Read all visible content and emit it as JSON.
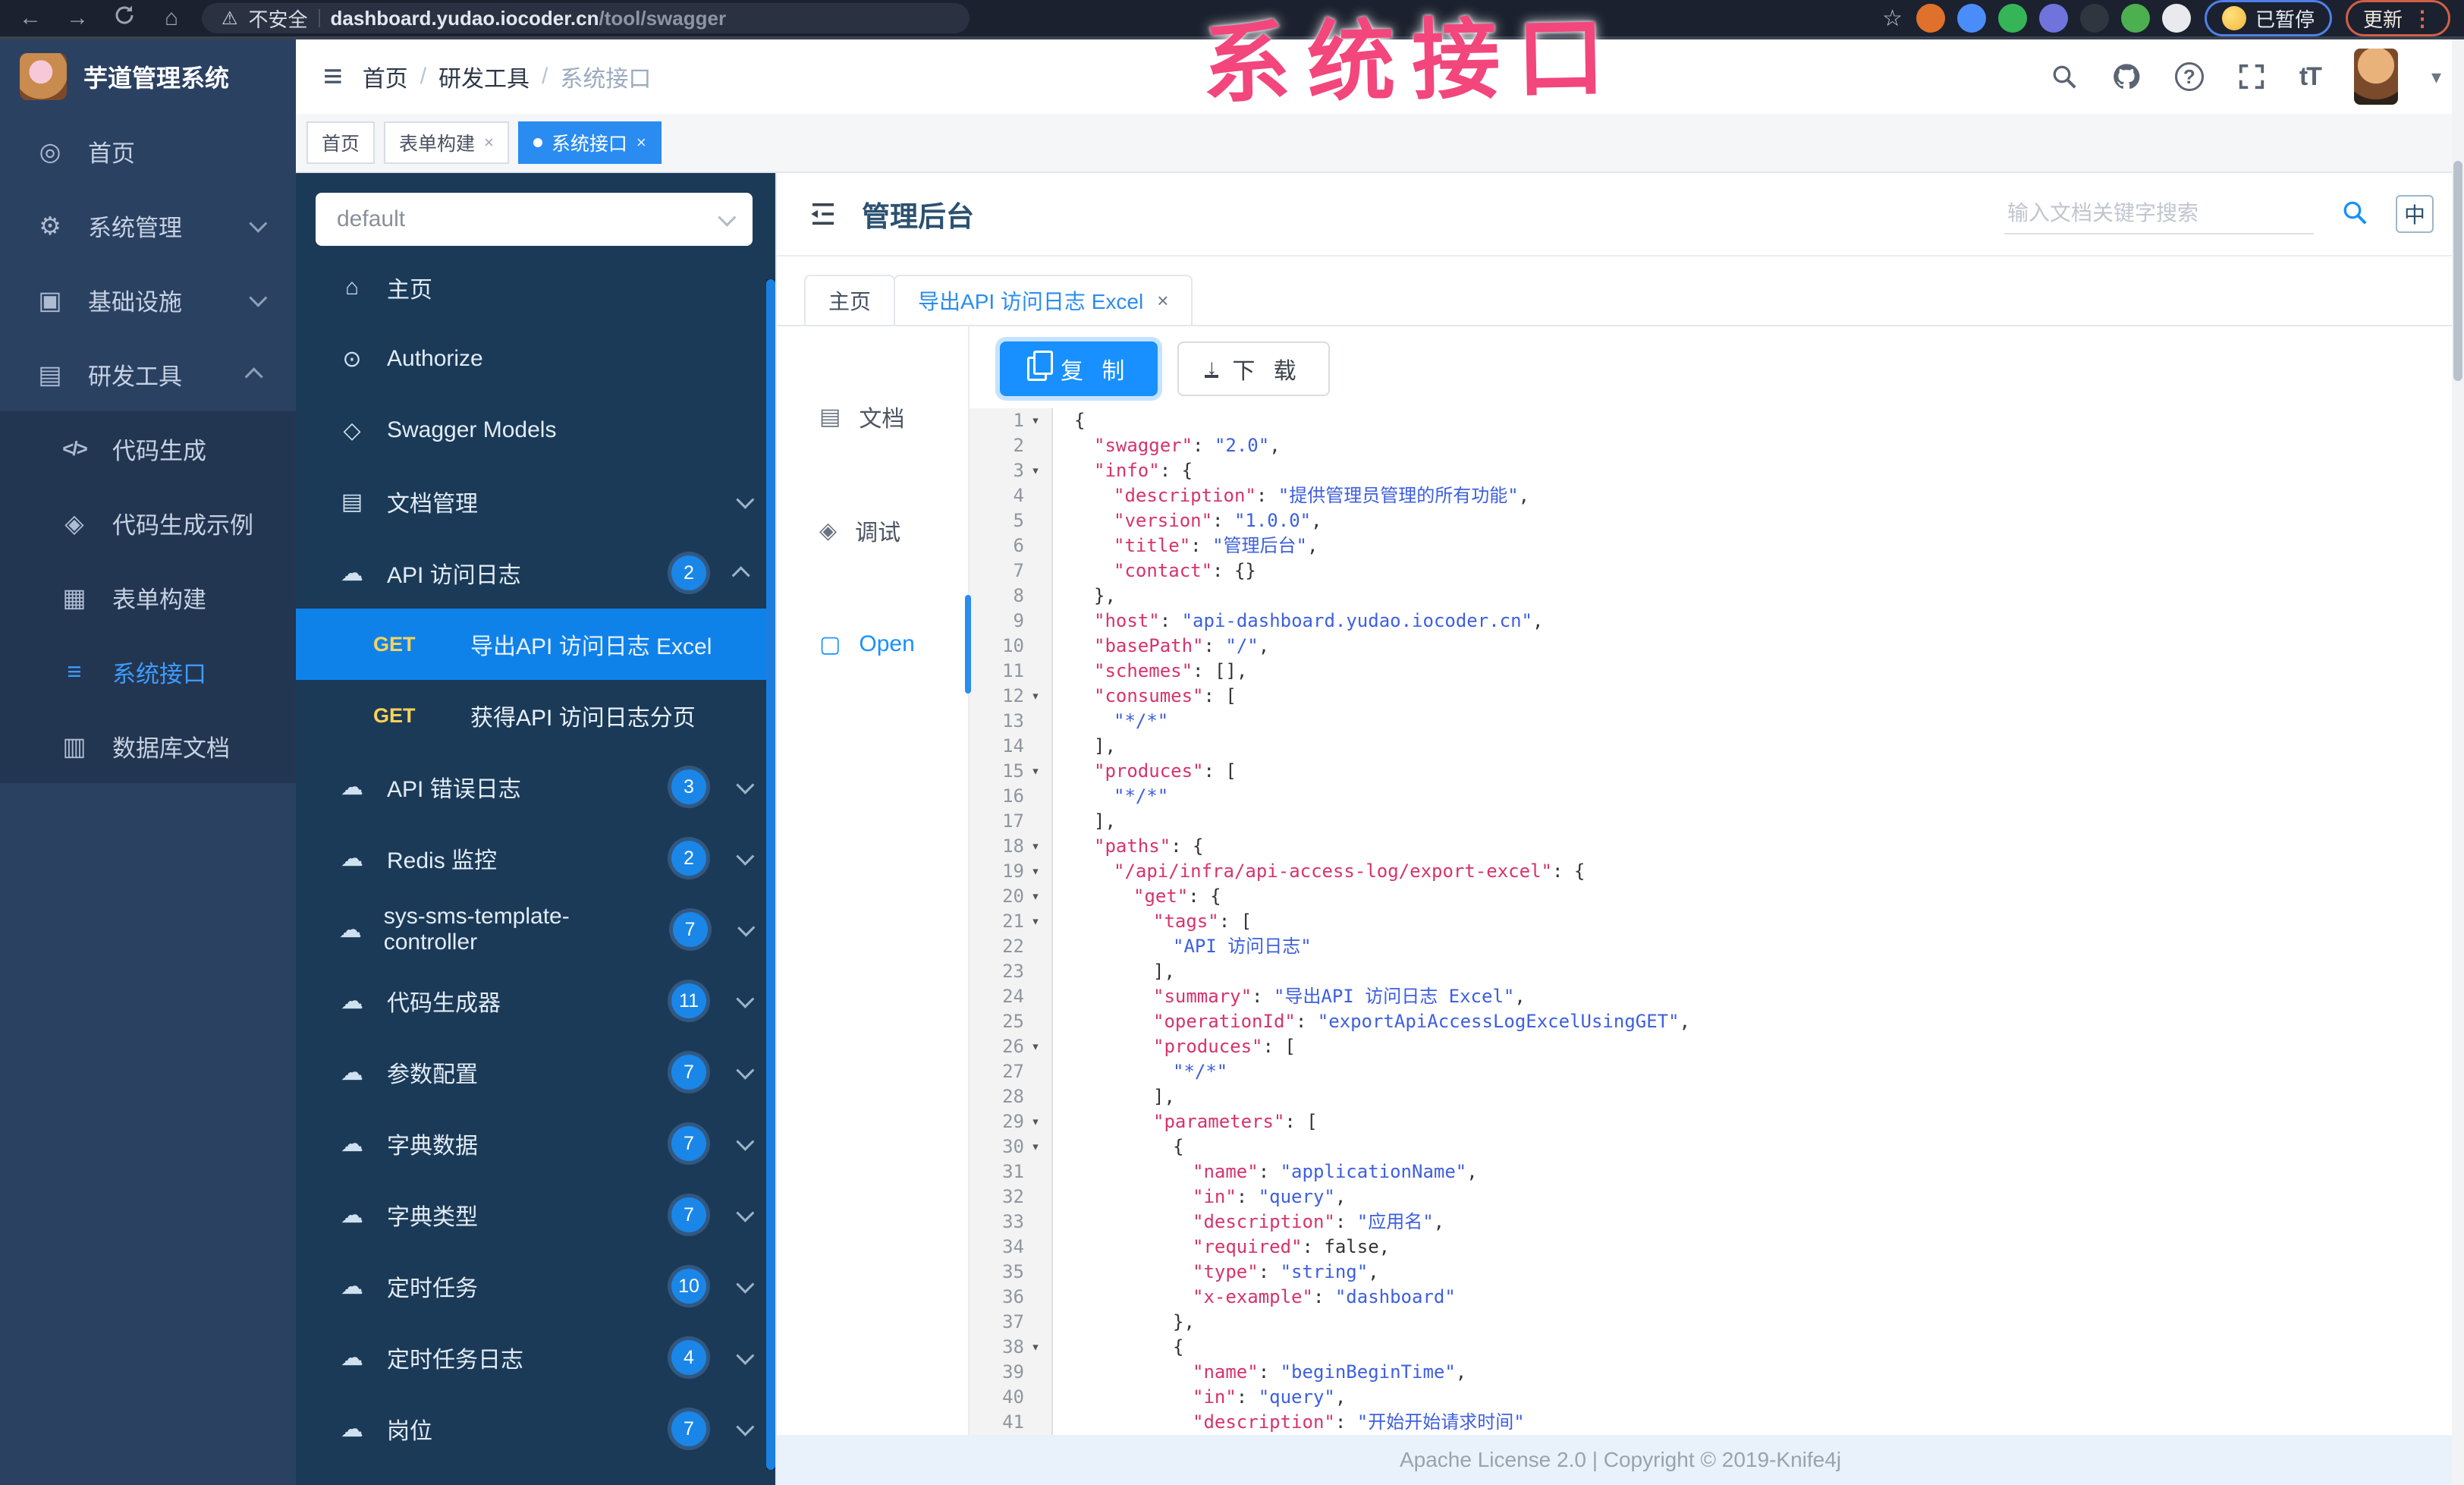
{
  "browser": {
    "security_label": "不安全",
    "url_host": "dashboard.yudao.iocoder.cn",
    "url_path": "/tool/swagger",
    "paused_label": "已暂停",
    "update_label": "更新",
    "menu_dots": "⋮",
    "extensions": [
      "#e0712c",
      "#4b8df8",
      "#35b558",
      "#6f74dd",
      "#2f3640",
      "#4caf50",
      "#e8eaed"
    ]
  },
  "overlay": {
    "title": "系统接口"
  },
  "logo": {
    "title": "芋道管理系统"
  },
  "sidebar": {
    "items": [
      {
        "id": "home",
        "label": "首页",
        "icon": "dashboard",
        "glyph": "◎"
      },
      {
        "id": "system",
        "label": "系统管理",
        "icon": "gear",
        "glyph": "⚙",
        "chevron": "down"
      },
      {
        "id": "infra",
        "label": "基础设施",
        "icon": "monitor",
        "glyph": "▣",
        "chevron": "down"
      },
      {
        "id": "devtools",
        "label": "研发工具",
        "icon": "toolbox",
        "glyph": "▤",
        "chevron": "up"
      }
    ],
    "subitems": [
      {
        "id": "codegen",
        "label": "代码生成",
        "icon": "code",
        "glyph": "</>"
      },
      {
        "id": "codegen-demo",
        "label": "代码生成示例",
        "icon": "shield",
        "glyph": "◈"
      },
      {
        "id": "form-builder",
        "label": "表单构建",
        "icon": "form",
        "glyph": "▦"
      },
      {
        "id": "api-doc",
        "label": "系统接口",
        "icon": "api",
        "glyph": "≡",
        "active": true
      },
      {
        "id": "db-doc",
        "label": "数据库文档",
        "icon": "database",
        "glyph": "▥"
      }
    ]
  },
  "header": {
    "breadcrumb": [
      "首页",
      "研发工具",
      "系统接口"
    ],
    "font_icon": "tT"
  },
  "tags": [
    {
      "label": "首页"
    },
    {
      "label": "表单构建",
      "closable": true
    },
    {
      "label": "系统接口",
      "closable": true,
      "active": true
    }
  ],
  "api_sidebar": {
    "group_select": "default",
    "items": [
      {
        "label": "主页",
        "icon": "home"
      },
      {
        "label": "Authorize",
        "icon": "auth"
      },
      {
        "label": "Swagger Models",
        "icon": "models"
      },
      {
        "label": "文档管理",
        "icon": "doc",
        "chevron": "down"
      },
      {
        "label": "API 访问日志",
        "icon": "cloud",
        "badge": "2",
        "chevron": "up",
        "children": [
          {
            "method": "GET",
            "label": "导出API 访问日志 Excel",
            "selected": true
          },
          {
            "method": "GET",
            "label": "获得API 访问日志分页"
          }
        ]
      },
      {
        "label": "API 错误日志",
        "icon": "cloud",
        "badge": "3",
        "chevron": "down"
      },
      {
        "label": "Redis 监控",
        "icon": "cloud",
        "badge": "2",
        "chevron": "down"
      },
      {
        "label": "sys-sms-template-controller",
        "icon": "cloud",
        "badge": "7",
        "chevron": "down"
      },
      {
        "label": "代码生成器",
        "icon": "cloud",
        "badge": "11",
        "chevron": "down"
      },
      {
        "label": "参数配置",
        "icon": "cloud",
        "badge": "7",
        "chevron": "down"
      },
      {
        "label": "字典数据",
        "icon": "cloud",
        "badge": "7",
        "chevron": "down"
      },
      {
        "label": "字典类型",
        "icon": "cloud",
        "badge": "7",
        "chevron": "down"
      },
      {
        "label": "定时任务",
        "icon": "cloud",
        "badge": "10",
        "chevron": "down"
      },
      {
        "label": "定时任务日志",
        "icon": "cloud",
        "badge": "4",
        "chevron": "down"
      },
      {
        "label": "岗位",
        "icon": "cloud",
        "badge": "7",
        "chevron": "down",
        "partial": true
      }
    ]
  },
  "doc": {
    "title": "管理后台",
    "search_placeholder": "输入文档关键字搜索",
    "lang_icon": "中",
    "tabs": [
      {
        "label": "主页"
      },
      {
        "label": "导出API 访问日志 Excel",
        "closable": true,
        "active": true
      }
    ],
    "nav": [
      {
        "label": "文档",
        "icon": "file"
      },
      {
        "label": "调试",
        "icon": "debug"
      },
      {
        "label": "Open",
        "icon": "open",
        "active": true
      }
    ],
    "copy_label": "复 制",
    "download_label": "下 载",
    "footer": "Apache License 2.0 | Copyright © 2019-Knife4j"
  },
  "editor": {
    "lines": [
      {
        "n": 1,
        "f": true,
        "i": 0,
        "t": [
          [
            "p",
            "{"
          ]
        ]
      },
      {
        "n": 2,
        "f": false,
        "i": 1,
        "t": [
          [
            "k",
            "\"swagger\""
          ],
          [
            "p",
            ": "
          ],
          [
            "s",
            "\"2.0\""
          ],
          [
            "p",
            ","
          ]
        ]
      },
      {
        "n": 3,
        "f": true,
        "i": 1,
        "t": [
          [
            "k",
            "\"info\""
          ],
          [
            "p",
            ": {"
          ]
        ]
      },
      {
        "n": 4,
        "f": false,
        "i": 2,
        "t": [
          [
            "k",
            "\"description\""
          ],
          [
            "p",
            ": "
          ],
          [
            "s",
            "\"提供管理员管理的所有功能\""
          ],
          [
            "p",
            ","
          ]
        ]
      },
      {
        "n": 5,
        "f": false,
        "i": 2,
        "t": [
          [
            "k",
            "\"version\""
          ],
          [
            "p",
            ": "
          ],
          [
            "s",
            "\"1.0.0\""
          ],
          [
            "p",
            ","
          ]
        ]
      },
      {
        "n": 6,
        "f": false,
        "i": 2,
        "t": [
          [
            "k",
            "\"title\""
          ],
          [
            "p",
            ": "
          ],
          [
            "s",
            "\"管理后台\""
          ],
          [
            "p",
            ","
          ]
        ]
      },
      {
        "n": 7,
        "f": false,
        "i": 2,
        "t": [
          [
            "k",
            "\"contact\""
          ],
          [
            "p",
            ": {}"
          ]
        ]
      },
      {
        "n": 8,
        "f": false,
        "i": 1,
        "t": [
          [
            "p",
            "},"
          ]
        ]
      },
      {
        "n": 9,
        "f": false,
        "i": 1,
        "t": [
          [
            "k",
            "\"host\""
          ],
          [
            "p",
            ": "
          ],
          [
            "s",
            "\"api-dashboard.yudao.iocoder.cn\""
          ],
          [
            "p",
            ","
          ]
        ]
      },
      {
        "n": 10,
        "f": false,
        "i": 1,
        "t": [
          [
            "k",
            "\"basePath\""
          ],
          [
            "p",
            ": "
          ],
          [
            "s",
            "\"/\""
          ],
          [
            "p",
            ","
          ]
        ]
      },
      {
        "n": 11,
        "f": false,
        "i": 1,
        "t": [
          [
            "k",
            "\"schemes\""
          ],
          [
            "p",
            ": [],"
          ]
        ]
      },
      {
        "n": 12,
        "f": true,
        "i": 1,
        "t": [
          [
            "k",
            "\"consumes\""
          ],
          [
            "p",
            ": ["
          ]
        ]
      },
      {
        "n": 13,
        "f": false,
        "i": 2,
        "t": [
          [
            "s",
            "\"*/*\""
          ]
        ]
      },
      {
        "n": 14,
        "f": false,
        "i": 1,
        "t": [
          [
            "p",
            "],"
          ]
        ]
      },
      {
        "n": 15,
        "f": true,
        "i": 1,
        "t": [
          [
            "k",
            "\"produces\""
          ],
          [
            "p",
            ": ["
          ]
        ]
      },
      {
        "n": 16,
        "f": false,
        "i": 2,
        "t": [
          [
            "s",
            "\"*/*\""
          ]
        ]
      },
      {
        "n": 17,
        "f": false,
        "i": 1,
        "t": [
          [
            "p",
            "],"
          ]
        ]
      },
      {
        "n": 18,
        "f": true,
        "i": 1,
        "t": [
          [
            "k",
            "\"paths\""
          ],
          [
            "p",
            ": {"
          ]
        ]
      },
      {
        "n": 19,
        "f": true,
        "i": 2,
        "t": [
          [
            "k",
            "\"/api/infra/api-access-log/export-excel\""
          ],
          [
            "p",
            ": {"
          ]
        ]
      },
      {
        "n": 20,
        "f": true,
        "i": 3,
        "t": [
          [
            "k",
            "\"get\""
          ],
          [
            "p",
            ": {"
          ]
        ]
      },
      {
        "n": 21,
        "f": true,
        "i": 4,
        "t": [
          [
            "k",
            "\"tags\""
          ],
          [
            "p",
            ": ["
          ]
        ]
      },
      {
        "n": 22,
        "f": false,
        "i": 5,
        "t": [
          [
            "s",
            "\"API 访问日志\""
          ]
        ]
      },
      {
        "n": 23,
        "f": false,
        "i": 4,
        "t": [
          [
            "p",
            "],"
          ]
        ]
      },
      {
        "n": 24,
        "f": false,
        "i": 4,
        "t": [
          [
            "k",
            "\"summary\""
          ],
          [
            "p",
            ": "
          ],
          [
            "s",
            "\"导出API 访问日志 Excel\""
          ],
          [
            "p",
            ","
          ]
        ]
      },
      {
        "n": 25,
        "f": false,
        "i": 4,
        "t": [
          [
            "k",
            "\"operationId\""
          ],
          [
            "p",
            ": "
          ],
          [
            "s",
            "\"exportApiAccessLogExcelUsingGET\""
          ],
          [
            "p",
            ","
          ]
        ]
      },
      {
        "n": 26,
        "f": true,
        "i": 4,
        "t": [
          [
            "k",
            "\"produces\""
          ],
          [
            "p",
            ": ["
          ]
        ]
      },
      {
        "n": 27,
        "f": false,
        "i": 5,
        "t": [
          [
            "s",
            "\"*/*\""
          ]
        ]
      },
      {
        "n": 28,
        "f": false,
        "i": 4,
        "t": [
          [
            "p",
            "],"
          ]
        ]
      },
      {
        "n": 29,
        "f": true,
        "i": 4,
        "t": [
          [
            "k",
            "\"parameters\""
          ],
          [
            "p",
            ": ["
          ]
        ]
      },
      {
        "n": 30,
        "f": true,
        "i": 5,
        "t": [
          [
            "p",
            "{"
          ]
        ]
      },
      {
        "n": 31,
        "f": false,
        "i": 6,
        "t": [
          [
            "k",
            "\"name\""
          ],
          [
            "p",
            ": "
          ],
          [
            "s",
            "\"applicationName\""
          ],
          [
            "p",
            ","
          ]
        ]
      },
      {
        "n": 32,
        "f": false,
        "i": 6,
        "t": [
          [
            "k",
            "\"in\""
          ],
          [
            "p",
            ": "
          ],
          [
            "s",
            "\"query\""
          ],
          [
            "p",
            ","
          ]
        ]
      },
      {
        "n": 33,
        "f": false,
        "i": 6,
        "t": [
          [
            "k",
            "\"description\""
          ],
          [
            "p",
            ": "
          ],
          [
            "s",
            "\"应用名\""
          ],
          [
            "p",
            ","
          ]
        ]
      },
      {
        "n": 34,
        "f": false,
        "i": 6,
        "t": [
          [
            "k",
            "\"required\""
          ],
          [
            "p",
            ": "
          ],
          [
            "b",
            "false"
          ],
          [
            "p",
            ","
          ]
        ]
      },
      {
        "n": 35,
        "f": false,
        "i": 6,
        "t": [
          [
            "k",
            "\"type\""
          ],
          [
            "p",
            ": "
          ],
          [
            "s",
            "\"string\""
          ],
          [
            "p",
            ","
          ]
        ]
      },
      {
        "n": 36,
        "f": false,
        "i": 6,
        "t": [
          [
            "k",
            "\"x-example\""
          ],
          [
            "p",
            ": "
          ],
          [
            "s",
            "\"dashboard\""
          ]
        ]
      },
      {
        "n": 37,
        "f": false,
        "i": 5,
        "t": [
          [
            "p",
            "},"
          ]
        ]
      },
      {
        "n": 38,
        "f": true,
        "i": 5,
        "t": [
          [
            "p",
            "{"
          ]
        ]
      },
      {
        "n": 39,
        "f": false,
        "i": 6,
        "t": [
          [
            "k",
            "\"name\""
          ],
          [
            "p",
            ": "
          ],
          [
            "s",
            "\"beginBeginTime\""
          ],
          [
            "p",
            ","
          ]
        ]
      },
      {
        "n": 40,
        "f": false,
        "i": 6,
        "t": [
          [
            "k",
            "\"in\""
          ],
          [
            "p",
            ": "
          ],
          [
            "s",
            "\"query\""
          ],
          [
            "p",
            ","
          ]
        ]
      },
      {
        "n": 41,
        "f": false,
        "i": 6,
        "t": [
          [
            "k",
            "\"description\""
          ],
          [
            "p",
            ": "
          ],
          [
            "s",
            "\"开始开始请求时间\""
          ]
        ]
      }
    ]
  }
}
